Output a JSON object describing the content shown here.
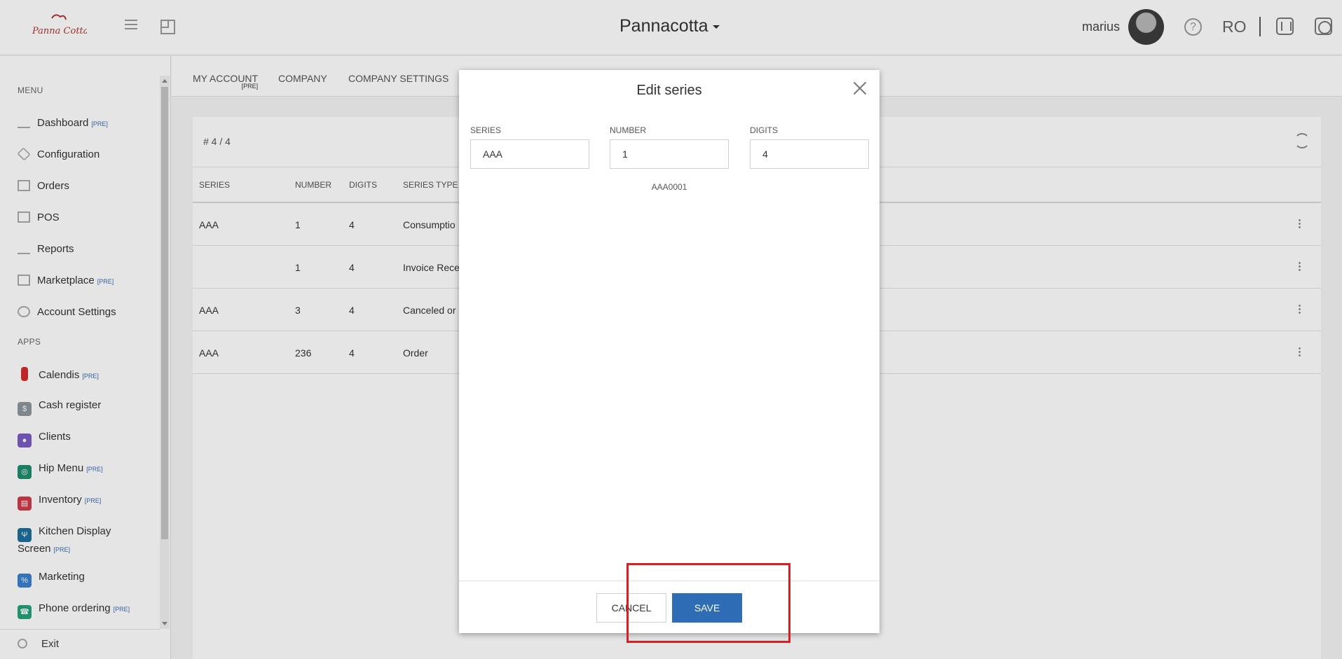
{
  "header": {
    "company": "Pannacotta",
    "username": "marius",
    "help": "?",
    "language": "RO"
  },
  "sidebar": {
    "menu_label": "MENU",
    "apps_label": "APPS",
    "pre_tag": "[PRE]",
    "menu": [
      {
        "label": "Dashboard",
        "pre": true,
        "icon": "chart-icon"
      },
      {
        "label": "Configuration",
        "pre": false,
        "icon": "tag-icon"
      },
      {
        "label": "Orders",
        "pre": false,
        "icon": "orders-icon"
      },
      {
        "label": "POS",
        "pre": false,
        "icon": "monitor-icon"
      },
      {
        "label": "Reports",
        "pre": false,
        "icon": "reports-icon"
      },
      {
        "label": "Marketplace",
        "pre": true,
        "icon": "cart-icon"
      },
      {
        "label": "Account Settings",
        "pre": false,
        "icon": "gear-icon"
      }
    ],
    "apps": [
      {
        "label": "Calendis",
        "pre": true,
        "color": "#d42b2b"
      },
      {
        "label": "Cash register",
        "pre": false,
        "color": "#8e969c"
      },
      {
        "label": "Clients",
        "pre": false,
        "color": "#7a5cc6"
      },
      {
        "label": "Hip Menu",
        "pre": true,
        "color": "#1f8c6e"
      },
      {
        "label": "Inventory",
        "pre": true,
        "color": "#d23a4a"
      },
      {
        "label": "Kitchen Display",
        "label2": "Screen",
        "pre": true,
        "color": "#1d6f9e"
      },
      {
        "label": "Marketing",
        "pre": false,
        "color": "#3a7fcf"
      },
      {
        "label": "Phone ordering",
        "pre": true,
        "color": "#23a27a"
      }
    ],
    "exit": "Exit"
  },
  "tabs": {
    "my_account": "MY ACCOUNT",
    "my_account_pre": "[PRE]",
    "company": "COMPANY",
    "company_settings": "COMPANY SETTINGS"
  },
  "table": {
    "count": "# 4 / 4",
    "headers": [
      "SERIES",
      "NUMBER",
      "DIGITS",
      "SERIES TYPE"
    ],
    "rows": [
      [
        "AAA",
        "1",
        "4",
        "Consumptio"
      ],
      [
        "",
        "1",
        "4",
        "Invoice Rece"
      ],
      [
        "AAA",
        "3",
        "4",
        "Canceled or"
      ],
      [
        "AAA",
        "236",
        "4",
        "Order"
      ]
    ]
  },
  "modal": {
    "title": "Edit series",
    "series_label": "SERIES",
    "series_value": "AAA",
    "number_label": "NUMBER",
    "number_value": "1",
    "digits_label": "DIGITS",
    "digits_value": "4",
    "preview": "AAA0001",
    "cancel": "CANCEL",
    "save": "SAVE"
  },
  "colors": {
    "primary": "#2e6db5",
    "highlight": "#d81f26"
  }
}
